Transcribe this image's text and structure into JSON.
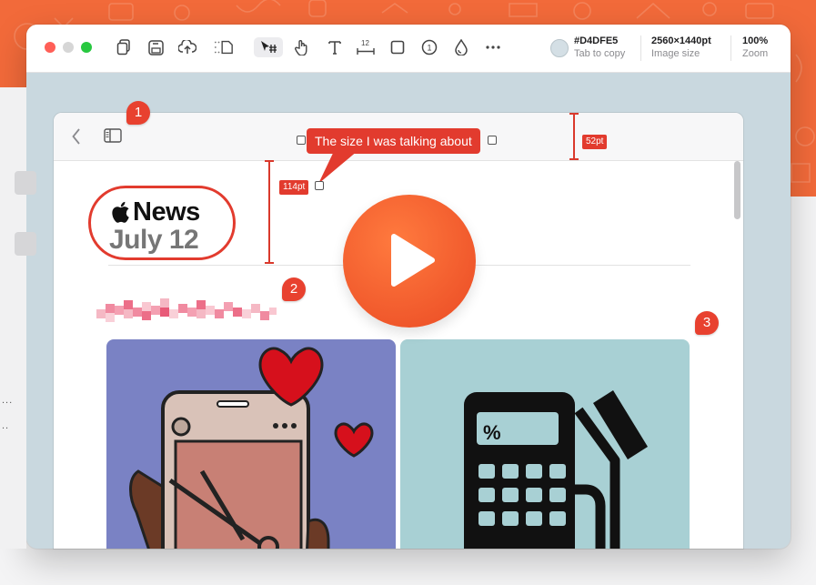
{
  "toolbar": {
    "color": {
      "hex": "#D4DFE5",
      "label": "Tab to copy"
    },
    "image_size": {
      "value": "2560×1440pt",
      "label": "Image size"
    },
    "zoom": {
      "value": "100%",
      "label": "Zoom"
    },
    "tools": [
      "copy-icon",
      "save-icon",
      "upload-icon",
      "crop-icon",
      "select-tool-icon",
      "hand-tool-icon",
      "text-tool-icon",
      "measure-tool-icon",
      "rectangle-tool-icon",
      "counter-tool-icon",
      "blur-tool-icon",
      "more-icon"
    ],
    "measure_tool_number": "12",
    "counter_tool_number": "1"
  },
  "annotations": {
    "callout_text": "The size I was talking about",
    "measure_left": "114pt",
    "measure_right": "52pt",
    "badges": [
      "1",
      "2",
      "3"
    ]
  },
  "article": {
    "logo_line1": "News",
    "logo_line2": "July 12"
  },
  "left_strip": {
    "dots1": "...",
    "dots2": ".."
  },
  "colors": {
    "accent": "#e23b2e",
    "background": "#f26a3a",
    "card_blue": "#7a82c4",
    "card_teal": "#a8d0d4"
  }
}
